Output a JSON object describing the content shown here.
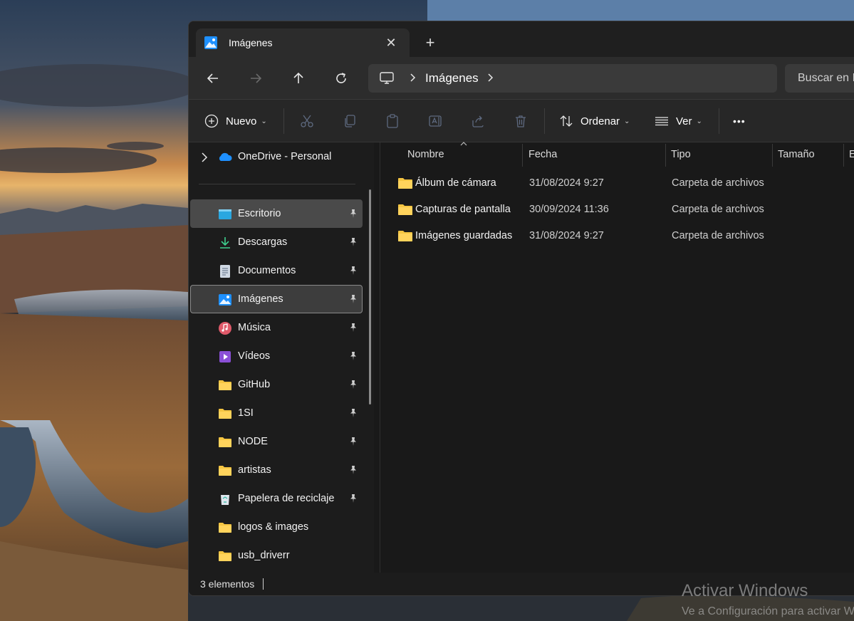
{
  "window": {
    "tab_title": "Imágenes",
    "tab_close": "✕",
    "new_tab": "+"
  },
  "navigation": {
    "breadcrumb": "Imágenes",
    "search_placeholder": "Buscar en Imágenes"
  },
  "toolbar": {
    "new_label": "Nuevo",
    "sort_label": "Ordenar",
    "view_label": "Ver",
    "more": "•••"
  },
  "sidebar": {
    "onedrive": "OneDrive - Personal",
    "items": [
      {
        "label": "Escritorio",
        "icon": "desktop-icon",
        "pinned": true
      },
      {
        "label": "Descargas",
        "icon": "download-icon",
        "pinned": true
      },
      {
        "label": "Documentos",
        "icon": "document-icon",
        "pinned": true
      },
      {
        "label": "Imágenes",
        "icon": "pictures-icon",
        "pinned": true
      },
      {
        "label": "Música",
        "icon": "music-icon",
        "pinned": true
      },
      {
        "label": "Vídeos",
        "icon": "video-icon",
        "pinned": true
      },
      {
        "label": "GitHub",
        "icon": "folder-icon",
        "pinned": true
      },
      {
        "label": "1SI",
        "icon": "folder-icon",
        "pinned": true
      },
      {
        "label": "NODE",
        "icon": "folder-icon",
        "pinned": true
      },
      {
        "label": "artistas",
        "icon": "folder-icon",
        "pinned": true
      },
      {
        "label": "Papelera de reciclaje",
        "icon": "recycle-bin-icon",
        "pinned": true
      },
      {
        "label": "logos & images",
        "icon": "folder-icon",
        "pinned": false
      },
      {
        "label": "usb_driverr",
        "icon": "folder-icon",
        "pinned": false
      }
    ]
  },
  "columns": {
    "name": "Nombre",
    "date": "Fecha",
    "type": "Tipo",
    "size": "Tamaño",
    "extra": "E"
  },
  "files": [
    {
      "name": "Álbum de cámara",
      "date": "31/08/2024 9:27",
      "type": "Carpeta de archivos"
    },
    {
      "name": "Capturas de pantalla",
      "date": "30/09/2024 11:36",
      "type": "Carpeta de archivos"
    },
    {
      "name": "Imágenes guardadas",
      "date": "31/08/2024 9:27",
      "type": "Carpeta de archivos"
    }
  ],
  "status": {
    "count": "3 elementos"
  },
  "watermark": {
    "title": "Activar Windows",
    "subtitle": "Ve a Configuración para activar Windows."
  },
  "colors": {
    "folder": "#f5c542",
    "accent": "#4cc2ff"
  }
}
